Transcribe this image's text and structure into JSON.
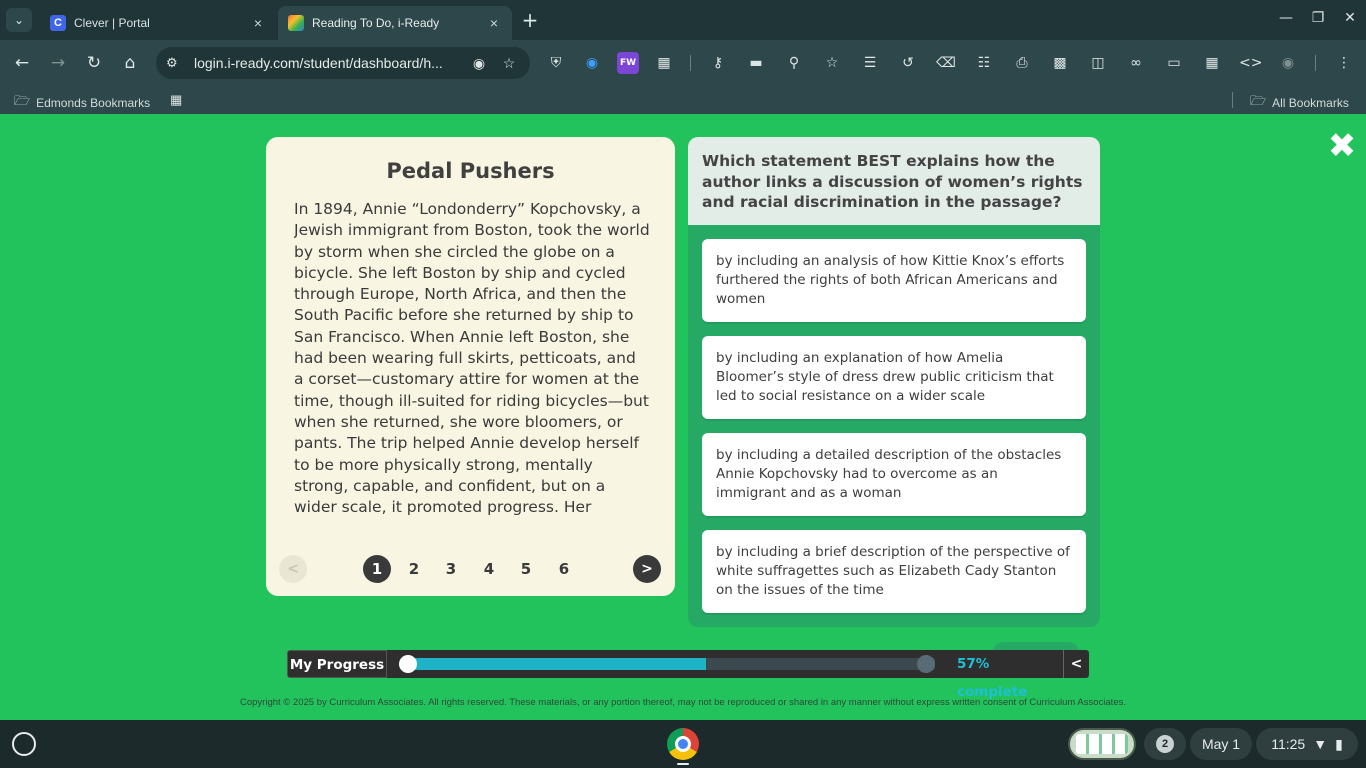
{
  "browser": {
    "tabs": [
      {
        "title": "Clever | Portal",
        "favicon": "C"
      },
      {
        "title": "Reading To Do, i-Ready",
        "favicon": ""
      }
    ],
    "new_tab_icon": "+",
    "tab_close_icon": "×",
    "tab_search_icon": "⌄",
    "url": "login.i-ready.com/student/dashboard/h...",
    "bookmarks": {
      "left": "Edmonds Bookmarks",
      "right": "All Bookmarks"
    },
    "extension_fw_label": "FW"
  },
  "passage": {
    "title": "Pedal Pushers",
    "body": "In 1894, Annie “Londonderry” Kopchovsky, a Jewish immigrant from Boston, took the world by storm when she circled the globe on a bicycle. She left Boston by ship and cycled through Europe, North Africa, and then the South Pacific before she returned by ship to San Francisco. When Annie left Boston, she had been wearing full skirts, petticoats, and a corset—customary attire for women at the time, though ill-suited for riding bicycles—but when she returned, she wore bloomers, or pants. The trip helped Annie develop herself to be more physically strong, mentally strong, capable, and confident, but on a wider scale, it promoted progress. Her groundbreaking trip",
    "pager": {
      "prev": "<",
      "next": ">",
      "pages": [
        "1",
        "2",
        "3",
        "4",
        "5",
        "6"
      ],
      "current": 1
    }
  },
  "question": {
    "text": "Which statement BEST explains how the author links a discussion of women’s rights and racial discrimination in the passage?",
    "answers": [
      "by including an analysis of how Kittie Knox’s efforts furthered the rights of both African Americans and women",
      "by including an explanation of how Amelia Bloomer’s style of dress drew public criticism that led to social resistance on a wider scale",
      "by including a detailed description of the obstacles Annie Kopchovsky had to overcome as an immigrant and as a woman",
      "by including a brief description of the perspective of white suffragettes such as Elizabeth Cady Stanton on the issues of the time"
    ]
  },
  "progress": {
    "label": "My Progress",
    "percent": 57,
    "text": "57% complete",
    "toggle": "<"
  },
  "copyright": "Copyright © 2025 by Curriculum Associates. All rights reserved. These materials, or any portion thereof, may not be reproduced or shared in any manner without express written consent of Curriculum Associates.",
  "shelf": {
    "notification_count": "2",
    "date": "May 1",
    "time": "11:25"
  },
  "colors": {
    "page_background": "#22c35d",
    "passage_background": "#f8f6e2",
    "question_panel": "#26a965",
    "progress_fill": "#1fb3c8"
  }
}
